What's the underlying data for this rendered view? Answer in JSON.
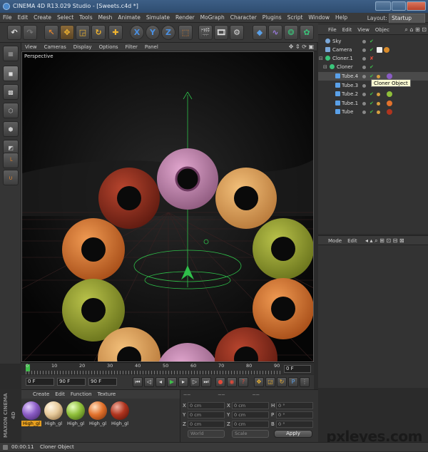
{
  "window": {
    "title": "CINEMA 4D R13.029 Studio - [Sweets.c4d *]"
  },
  "menubar": {
    "items": [
      "File",
      "Edit",
      "Create",
      "Select",
      "Tools",
      "Mesh",
      "Animate",
      "Simulate",
      "Render",
      "MoGraph",
      "Character",
      "Plugins",
      "Script",
      "Window",
      "Help"
    ],
    "layout_label": "Layout:",
    "layout_value": "Startup"
  },
  "toolbar": {
    "icons": [
      "undo-icon",
      "redo-icon",
      "live-select-icon",
      "move-icon",
      "scale-icon",
      "rotate-icon",
      "last-tool-icon",
      "x-axis-icon",
      "y-axis-icon",
      "z-axis-icon",
      "world-coord-icon",
      "render-view-icon",
      "render-picture-viewer-icon",
      "render-settings-icon",
      "cube-icon",
      "spline-icon",
      "nurbs-icon",
      "array-icon"
    ],
    "x_label": "X",
    "y_label": "Y",
    "z_label": "Z"
  },
  "viewport": {
    "menu": [
      "View",
      "Cameras",
      "Display",
      "Options",
      "Filter",
      "Panel"
    ],
    "label": "Perspective"
  },
  "object_manager": {
    "menu": [
      "File",
      "Edit",
      "View",
      "Objec"
    ],
    "objects": [
      {
        "name": "Sky",
        "indent": 0,
        "type": "sky"
      },
      {
        "name": "Camera",
        "indent": 0,
        "type": "camera"
      },
      {
        "name": "Cloner.1",
        "indent": 0,
        "type": "cloner"
      },
      {
        "name": "Cloner",
        "indent": 1,
        "type": "cloner"
      },
      {
        "name": "Tube.4",
        "indent": 2,
        "type": "tube"
      },
      {
        "name": "Tube.3",
        "indent": 2,
        "type": "tube"
      },
      {
        "name": "Tube.2",
        "indent": 2,
        "type": "tube"
      },
      {
        "name": "Tube.1",
        "indent": 2,
        "type": "tube"
      },
      {
        "name": "Tube",
        "indent": 2,
        "type": "tube"
      }
    ],
    "tooltip": "Cloner Object"
  },
  "attribute_manager": {
    "menu": [
      "Mode",
      "Edit"
    ]
  },
  "timeline": {
    "ticks": [
      "0",
      "10",
      "20",
      "30",
      "40",
      "50",
      "60",
      "70",
      "80",
      "90"
    ],
    "current_frame_field": "0 F",
    "start_field": "0 F",
    "end_field": "90 F",
    "end_field2": "90 F"
  },
  "material_manager": {
    "menu": [
      "Create",
      "Edit",
      "Function",
      "Texture"
    ],
    "materials": [
      {
        "label": "High_gl",
        "color": "#8a5cc4",
        "selected": true
      },
      {
        "label": "High_gl",
        "color": "#e6c99a",
        "selected": false
      },
      {
        "label": "High_gl",
        "color": "#8fbf3a",
        "selected": false
      },
      {
        "label": "High_gl",
        "color": "#e2722c",
        "selected": false
      },
      {
        "label": "High_gl",
        "color": "#b0341e",
        "selected": false
      }
    ]
  },
  "coordinates": {
    "rows": [
      {
        "a": "X",
        "av": "0 cm",
        "b": "X",
        "bv": "0 cm",
        "c": "H",
        "cv": "0 °"
      },
      {
        "a": "Y",
        "av": "0 cm",
        "b": "Y",
        "bv": "0 cm",
        "c": "P",
        "cv": "0 °"
      },
      {
        "a": "Z",
        "av": "0 cm",
        "b": "Z",
        "bv": "0 cm",
        "c": "B",
        "cv": "0 °"
      }
    ],
    "mode1": "World",
    "mode2": "Scale",
    "apply": "Apply"
  },
  "brand": "MAXON CINEMA 4D",
  "status": {
    "time": "00:00:11",
    "text": "Cloner Object"
  },
  "watermark": "pxleyes.com"
}
